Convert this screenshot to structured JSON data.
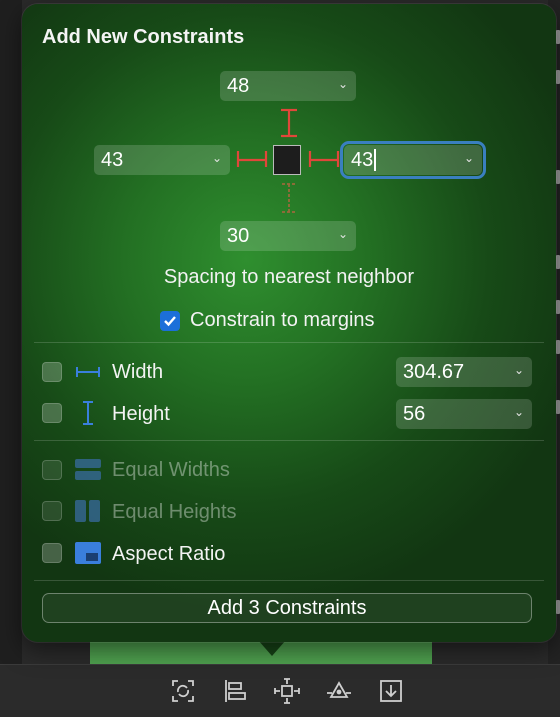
{
  "popover": {
    "title": "Add New Constraints",
    "top_spacing": "48",
    "left_spacing": "43",
    "right_spacing": "43",
    "bottom_spacing": "30",
    "spacing_label": "Spacing to nearest neighbor",
    "constrain_to_margins": {
      "label": "Constrain to margins",
      "checked": true
    },
    "width": {
      "label": "Width",
      "value": "304.67",
      "checked": false
    },
    "height": {
      "label": "Height",
      "value": "56",
      "checked": false
    },
    "equal_widths": {
      "label": "Equal Widths",
      "enabled": false
    },
    "equal_heights": {
      "label": "Equal Heights",
      "enabled": false
    },
    "aspect_ratio": {
      "label": "Aspect Ratio",
      "checked": false
    },
    "add_button": "Add 3 Constraints"
  },
  "colors": {
    "constraint_active": "#e0473a",
    "constraint_inactive": "#9a6a3a",
    "accent_blue": "#3a7fdc",
    "background_green": "#237023"
  },
  "icons": {
    "chevron": "chevron-down-icon",
    "bottom_bar": [
      "update-frames-icon",
      "align-icon",
      "add-constraints-icon",
      "resolve-issues-icon",
      "embed-in-icon"
    ]
  }
}
